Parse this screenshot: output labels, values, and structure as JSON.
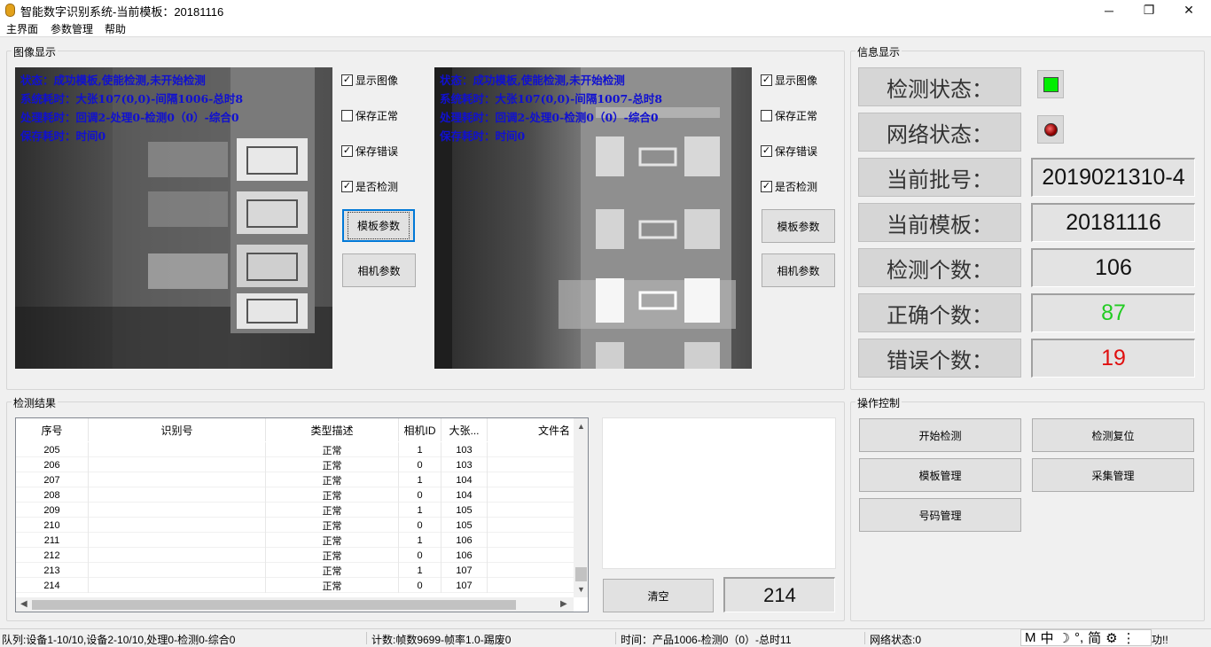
{
  "window": {
    "title": "智能数字识别系统-当前模板：20181116",
    "minimize_glyph": "─",
    "restore_glyph": "❐",
    "close_glyph": "✕"
  },
  "menu": [
    "主界面",
    "参数管理",
    "帮助"
  ],
  "image_group": {
    "title": "图像显示",
    "cameras": [
      {
        "overlay": [
          "状态：成功模板,使能检测,未开始检测",
          "系统耗时：大张107(0,0)-间隔1006-总时8",
          "处理耗时：回调2-处理0-检测0（0）-综合0",
          "保存耗时：时间0"
        ],
        "checkboxes": [
          {
            "label": "显示图像",
            "checked": true
          },
          {
            "label": "保存正常",
            "checked": false
          },
          {
            "label": "保存错误",
            "checked": true
          },
          {
            "label": "是否检测",
            "checked": true
          }
        ],
        "template_button": "模板参数",
        "camera_button": "相机参数"
      },
      {
        "overlay": [
          "状态：成功模板,使能检测,未开始检测",
          "系统耗时：大张107(0,0)-间隔1007-总时8",
          "处理耗时：回调2-处理0-检测0（0）-综合0",
          "保存耗时：时间0"
        ],
        "checkboxes": [
          {
            "label": "显示图像",
            "checked": true
          },
          {
            "label": "保存正常",
            "checked": false
          },
          {
            "label": "保存错误",
            "checked": true
          },
          {
            "label": "是否检测",
            "checked": true
          }
        ],
        "template_button": "模板参数",
        "camera_button": "相机参数"
      }
    ]
  },
  "info_group": {
    "title": "信息显示",
    "detect_status_label": "检测状态：",
    "network_status_label": "网络状态：",
    "detect_led_color": "#00ee00",
    "network_led_color": "#8b0000",
    "batch_label": "当前批号：",
    "batch_value": "2019021310-4",
    "template_label": "当前模板：",
    "template_value": "20181116",
    "count_label": "检测个数：",
    "count_value": "106",
    "correct_label": "正确个数：",
    "correct_value": "87",
    "correct_color": "#22cc22",
    "error_label": "错误个数：",
    "error_value": "19",
    "error_color": "#e01010"
  },
  "result_group": {
    "title": "检测结果",
    "columns": [
      "序号",
      "识别号",
      "类型描述",
      "相机ID",
      "大张...",
      "文件名"
    ],
    "rows": [
      [
        "205",
        "",
        "正常",
        "1",
        "103",
        ""
      ],
      [
        "206",
        "",
        "正常",
        "0",
        "103",
        ""
      ],
      [
        "207",
        "",
        "正常",
        "1",
        "104",
        ""
      ],
      [
        "208",
        "",
        "正常",
        "0",
        "104",
        ""
      ],
      [
        "209",
        "",
        "正常",
        "1",
        "105",
        ""
      ],
      [
        "210",
        "",
        "正常",
        "0",
        "105",
        ""
      ],
      [
        "211",
        "",
        "正常",
        "1",
        "106",
        ""
      ],
      [
        "212",
        "",
        "正常",
        "0",
        "106",
        ""
      ],
      [
        "213",
        "",
        "正常",
        "1",
        "107",
        ""
      ],
      [
        "214",
        "",
        "正常",
        "0",
        "107",
        ""
      ]
    ],
    "clear_button": "清空",
    "total_value": "214"
  },
  "ops_group": {
    "title": "操作控制",
    "buttons": [
      "开始检测",
      "检测复位",
      "模板管理",
      "采集管理",
      "号码管理"
    ]
  },
  "statusbar": {
    "queue": "队列:设备1-10/10,设备2-10/10,处理0-检测0-综合0",
    "count": "计数:帧数9699-帧率1.0-踢废0",
    "time": "时间：产品1006-检测0（0）-总时11",
    "network": "网络状态:0",
    "trailing": "功!!",
    "ime": [
      "M",
      "中",
      "☽",
      "°,",
      "简",
      "⚙",
      "⋮"
    ]
  }
}
